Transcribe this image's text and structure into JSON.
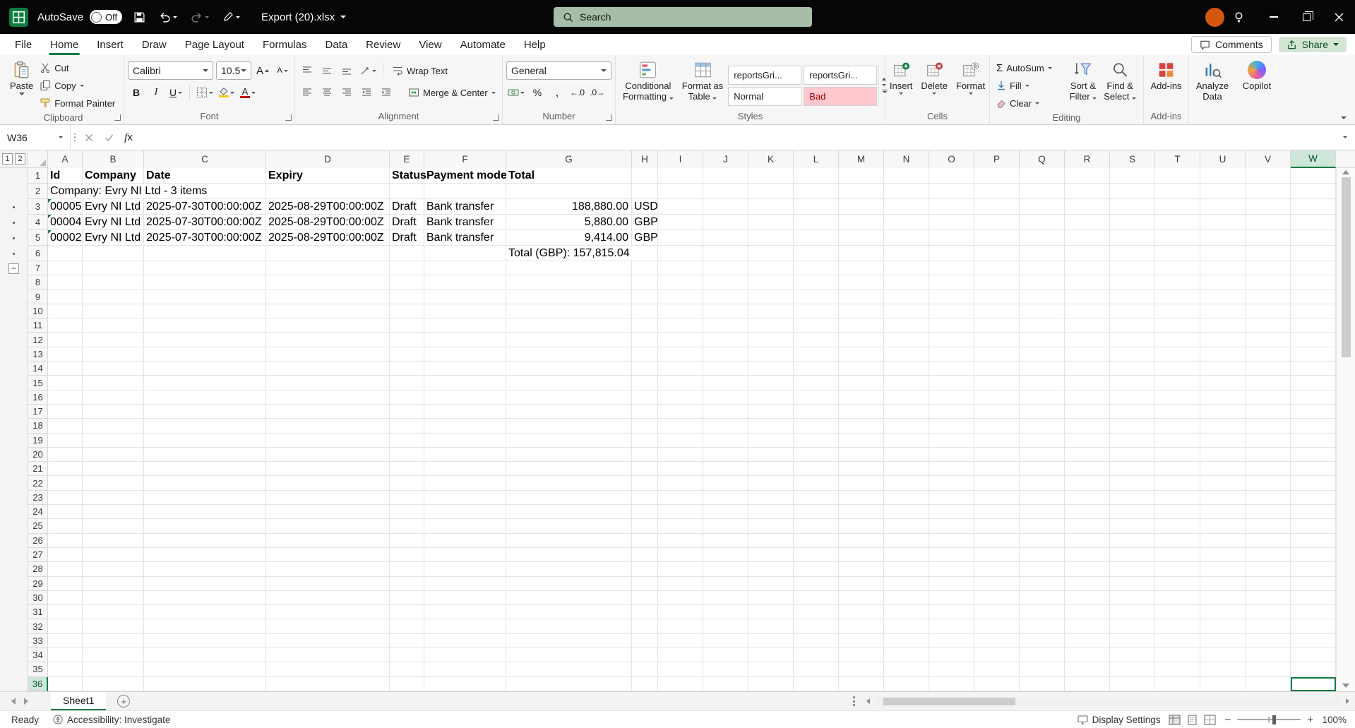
{
  "colors": {
    "accent_green": "#107C41",
    "title_bar": "#060606",
    "search_pill": "#A6BDA7",
    "bad_style_bg": "#FFC7CE",
    "bad_style_text": "#9C0006",
    "avatar_orange": "#D4570F",
    "selected_header_bg": "#CFE7DA"
  },
  "glyphs": {
    "bold": "B",
    "italic": "I",
    "underline": "U",
    "font_a": "A",
    "autosum_sigma": "Σ",
    "percent": "%",
    "comma": ",",
    "increase_decimal": "←.0",
    "decrease_decimal": ".0→",
    "plus": "+",
    "minus": "−"
  },
  "title_bar": {
    "autosave_label": "AutoSave",
    "autosave_state": "Off",
    "file_name": "Export (20).xlsx",
    "search_placeholder": "Search"
  },
  "menu_bar": {
    "tabs": [
      {
        "label": "File",
        "active": false
      },
      {
        "label": "Home",
        "active": true
      },
      {
        "label": "Insert",
        "active": false
      },
      {
        "label": "Draw",
        "active": false
      },
      {
        "label": "Page Layout",
        "active": false
      },
      {
        "label": "Formulas",
        "active": false
      },
      {
        "label": "Data",
        "active": false
      },
      {
        "label": "Review",
        "active": false
      },
      {
        "label": "View",
        "active": false
      },
      {
        "label": "Automate",
        "active": false
      },
      {
        "label": "Help",
        "active": false
      }
    ],
    "comments_label": "Comments",
    "share_label": "Share"
  },
  "ribbon": {
    "clipboard": {
      "label": "Clipboard",
      "paste": "Paste",
      "cut": "Cut",
      "copy": "Copy",
      "format_painter": "Format Painter"
    },
    "font": {
      "label": "Font",
      "family": "Calibri",
      "size": "10.5"
    },
    "alignment": {
      "label": "Alignment",
      "wrap_text": "Wrap Text",
      "merge_center": "Merge & Center"
    },
    "number": {
      "label": "Number",
      "format": "General"
    },
    "styles": {
      "label": "Styles",
      "conditional_line1": "Conditional",
      "conditional_line2": "Formatting",
      "format_table_line1": "Format as",
      "format_table_line2": "Table",
      "gallery": [
        "reportsGri...",
        "reportsGri...",
        "Normal",
        "Bad"
      ]
    },
    "cells": {
      "label": "Cells",
      "insert": "Insert",
      "delete": "Delete",
      "format": "Format"
    },
    "editing": {
      "label": "Editing",
      "autosum": "AutoSum",
      "fill": "Fill",
      "clear": "Clear",
      "sort_filter_line1": "Sort &",
      "sort_filter_line2": "Filter",
      "find_select_line1": "Find &",
      "find_select_line2": "Select"
    },
    "addins": {
      "label": "Add-ins",
      "addins": "Add-ins",
      "analyze_line1": "Analyze",
      "analyze_line2": "Data",
      "copilot": "Copilot"
    }
  },
  "formula_bar": {
    "name_box": "W36",
    "fx_label": "fx",
    "formula": ""
  },
  "sheet": {
    "column_letters": [
      "A",
      "B",
      "C",
      "D",
      "E",
      "F",
      "G",
      "H",
      "I",
      "J",
      "K",
      "L",
      "M",
      "N",
      "O",
      "P",
      "Q",
      "R",
      "S",
      "T",
      "U",
      "V",
      "W"
    ],
    "row_count": 36,
    "selected": {
      "cell_ref": "W36",
      "column": "W",
      "row": 36
    },
    "outline": {
      "levels": [
        "1",
        "2"
      ],
      "dot_rows": [
        3,
        4,
        5,
        6
      ],
      "collapse_row": 7,
      "collapse_glyph": "−"
    },
    "cells": [
      {
        "ref": "A1",
        "col": "A",
        "row": 1,
        "text": "Id",
        "bold": true
      },
      {
        "ref": "B1",
        "col": "B",
        "row": 1,
        "text": "Company",
        "bold": true
      },
      {
        "ref": "C1",
        "col": "C",
        "row": 1,
        "text": "Date",
        "bold": true
      },
      {
        "ref": "D1",
        "col": "D",
        "row": 1,
        "text": "Expiry",
        "bold": true
      },
      {
        "ref": "E1",
        "col": "E",
        "row": 1,
        "text": "Status",
        "bold": true
      },
      {
        "ref": "F1",
        "col": "F",
        "row": 1,
        "text": "Payment mode",
        "bold": true
      },
      {
        "ref": "G1",
        "col": "G",
        "row": 1,
        "text": "Total",
        "bold": true
      },
      {
        "ref": "A2",
        "col": "A",
        "row": 2,
        "text": "Company: Evry NI Ltd - 3 items",
        "spill": true
      },
      {
        "ref": "A3",
        "col": "A",
        "row": 3,
        "text": "00005",
        "flag": true
      },
      {
        "ref": "B3",
        "col": "B",
        "row": 3,
        "text": "Evry NI Ltd"
      },
      {
        "ref": "C3",
        "col": "C",
        "row": 3,
        "text": "2025-07-30T00:00:00Z"
      },
      {
        "ref": "D3",
        "col": "D",
        "row": 3,
        "text": "2025-08-29T00:00:00Z"
      },
      {
        "ref": "E3",
        "col": "E",
        "row": 3,
        "text": "Draft"
      },
      {
        "ref": "F3",
        "col": "F",
        "row": 3,
        "text": "Bank transfer"
      },
      {
        "ref": "G3",
        "col": "G",
        "row": 3,
        "text": "188,880.00",
        "align": "right"
      },
      {
        "ref": "H3",
        "col": "H",
        "row": 3,
        "text": "USD"
      },
      {
        "ref": "A4",
        "col": "A",
        "row": 4,
        "text": "00004",
        "flag": true
      },
      {
        "ref": "B4",
        "col": "B",
        "row": 4,
        "text": "Evry NI Ltd"
      },
      {
        "ref": "C4",
        "col": "C",
        "row": 4,
        "text": "2025-07-30T00:00:00Z"
      },
      {
        "ref": "D4",
        "col": "D",
        "row": 4,
        "text": "2025-08-29T00:00:00Z"
      },
      {
        "ref": "E4",
        "col": "E",
        "row": 4,
        "text": "Draft"
      },
      {
        "ref": "F4",
        "col": "F",
        "row": 4,
        "text": "Bank transfer"
      },
      {
        "ref": "G4",
        "col": "G",
        "row": 4,
        "text": "5,880.00",
        "align": "right"
      },
      {
        "ref": "H4",
        "col": "H",
        "row": 4,
        "text": "GBP"
      },
      {
        "ref": "A5",
        "col": "A",
        "row": 5,
        "text": "00002",
        "flag": true
      },
      {
        "ref": "B5",
        "col": "B",
        "row": 5,
        "text": "Evry NI Ltd"
      },
      {
        "ref": "C5",
        "col": "C",
        "row": 5,
        "text": "2025-07-30T00:00:00Z"
      },
      {
        "ref": "D5",
        "col": "D",
        "row": 5,
        "text": "2025-08-29T00:00:00Z"
      },
      {
        "ref": "E5",
        "col": "E",
        "row": 5,
        "text": "Draft"
      },
      {
        "ref": "F5",
        "col": "F",
        "row": 5,
        "text": "Bank transfer"
      },
      {
        "ref": "G5",
        "col": "G",
        "row": 5,
        "text": "9,414.00",
        "align": "right"
      },
      {
        "ref": "H5",
        "col": "H",
        "row": 5,
        "text": "GBP"
      },
      {
        "ref": "G6",
        "col": "G",
        "row": 6,
        "text": "Total (GBP): 157,815.04",
        "spill": true
      }
    ]
  },
  "tab_bar": {
    "sheets": [
      {
        "name": "Sheet1",
        "active": true
      }
    ]
  },
  "status_bar": {
    "ready": "Ready",
    "accessibility": "Accessibility: Investigate",
    "display_settings": "Display Settings",
    "zoom_percent": "100%"
  }
}
